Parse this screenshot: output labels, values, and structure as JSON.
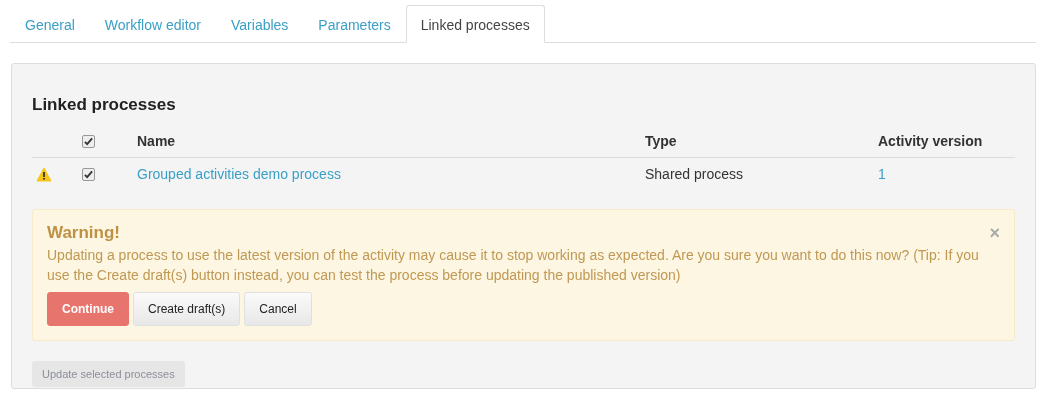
{
  "tabs": [
    {
      "label": "General",
      "selected": false
    },
    {
      "label": "Workflow editor",
      "selected": false
    },
    {
      "label": "Variables",
      "selected": false
    },
    {
      "label": "Parameters",
      "selected": false
    },
    {
      "label": "Linked processes",
      "selected": true
    }
  ],
  "panel": {
    "title": "Linked processes",
    "table": {
      "columns": [
        "Name",
        "Type",
        "Activity version"
      ],
      "select_all": {
        "checked": true
      },
      "rows": [
        {
          "warning": true,
          "checked": true,
          "name": "Grouped activities demo process",
          "type": "Shared process",
          "version": "1"
        }
      ]
    },
    "alert": {
      "title": "Warning!",
      "message": "Updating a process to use the latest version of the activity may cause it to stop working as expected. Are you sure you want to do this now? (Tip: If you use the Create draft(s) button instead, you can test the process before updating the published version)",
      "close": "×",
      "buttons": [
        {
          "label": "Continue",
          "kind": "danger"
        },
        {
          "label": "Create draft(s)",
          "kind": "default"
        },
        {
          "label": "Cancel",
          "kind": "default"
        }
      ]
    },
    "update_button": {
      "label": "Update selected processes",
      "disabled": true
    }
  }
}
